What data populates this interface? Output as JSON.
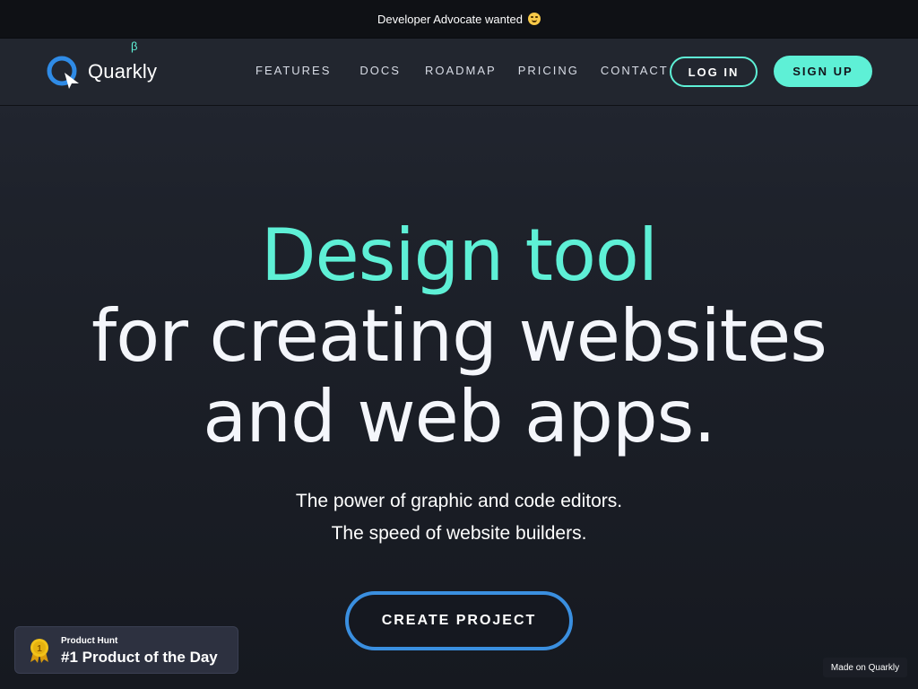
{
  "announcement": {
    "text": "Developer Advocate wanted",
    "emoji_icon": "hugging-face-emoji"
  },
  "header": {
    "logo_text": "Quarkly",
    "logo_beta": "β",
    "nav": [
      {
        "label": "FEATURES"
      },
      {
        "label": "DOCS"
      },
      {
        "label": "ROADMAP"
      },
      {
        "label": "PRICING"
      },
      {
        "label": "CONTACT"
      }
    ],
    "login_label": "LOG IN",
    "signup_label": "SIGN UP"
  },
  "hero": {
    "line1": "Design tool",
    "line2": "for creating websites",
    "line3": "and web apps.",
    "sub1": "The power of graphic and code editors.",
    "sub2": "The speed of website builders.",
    "cta_label": "CREATE PROJECT"
  },
  "product_hunt": {
    "small": "Product Hunt",
    "big": "#1 Product of the Day",
    "medal_number": "1"
  },
  "made_on": "Made on Quarkly",
  "colors": {
    "accent": "#5ef0d6",
    "cta_border": "#3a8fe0",
    "background": "#1e222b"
  }
}
